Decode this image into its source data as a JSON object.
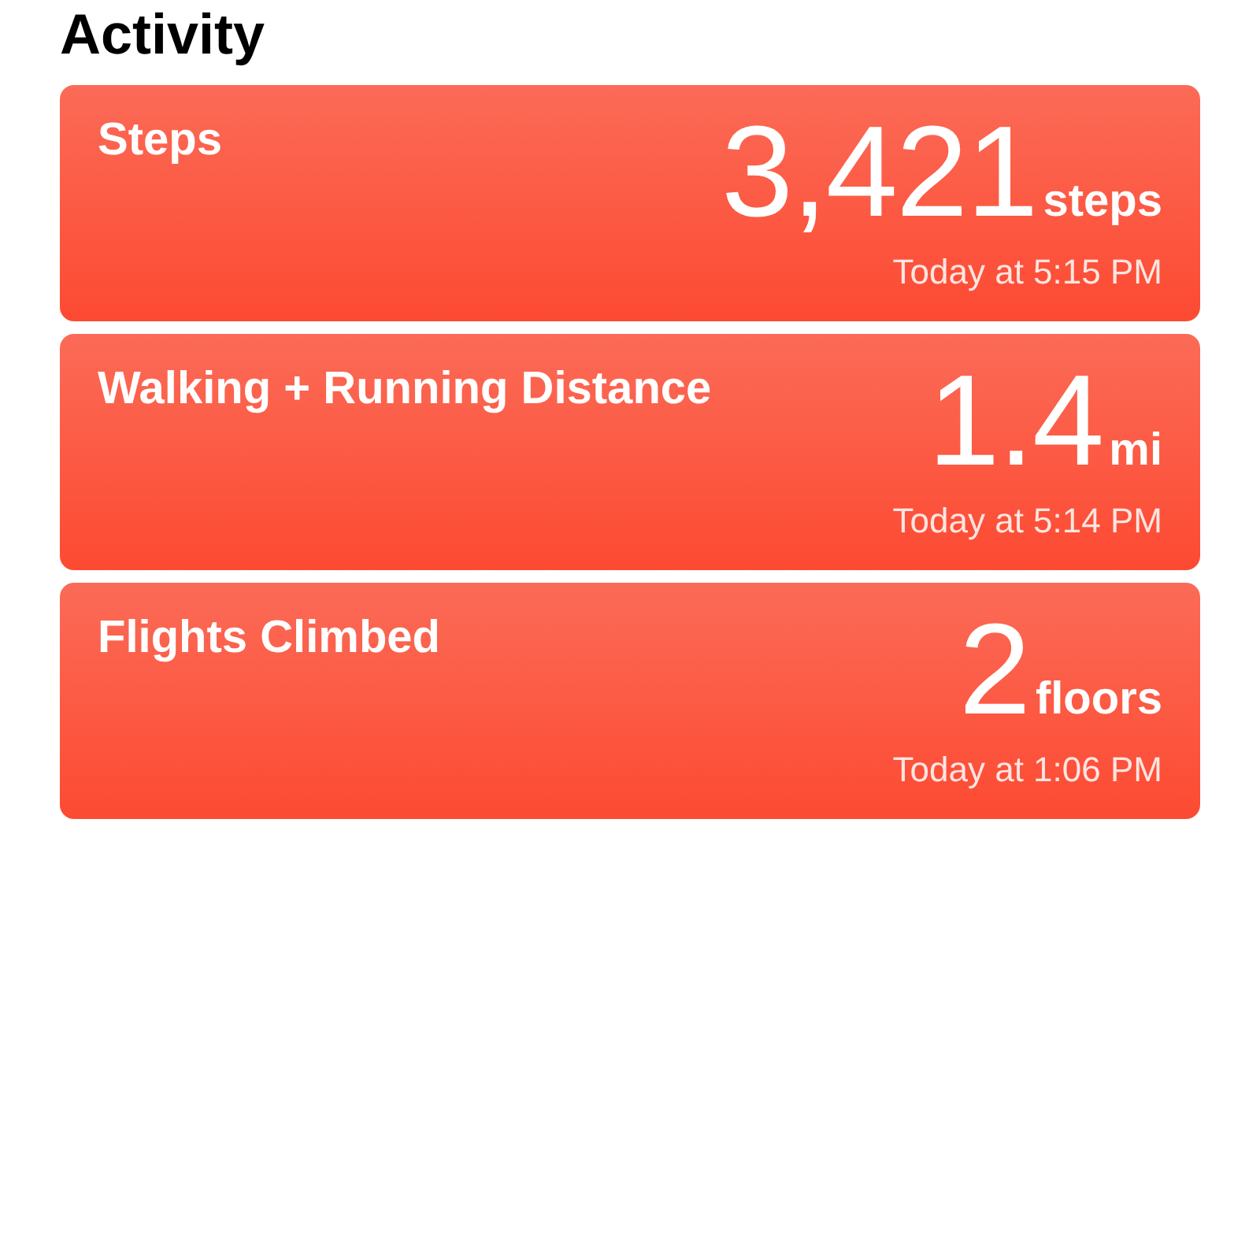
{
  "section_title": "Activity",
  "cards": [
    {
      "title": "Steps",
      "value": "3,421",
      "unit": "steps",
      "time": "Today at 5:15 PM"
    },
    {
      "title": "Walking + Running Distance",
      "value": "1.4",
      "unit": "mi",
      "time": "Today at 5:14 PM"
    },
    {
      "title": "Flights Climbed",
      "value": "2",
      "unit": "floors",
      "time": "Today at 1:06 PM"
    }
  ]
}
